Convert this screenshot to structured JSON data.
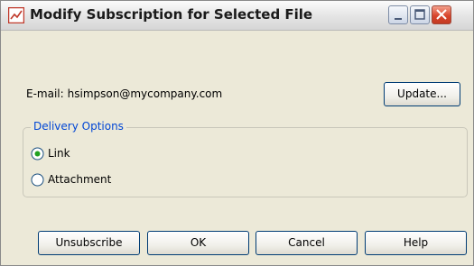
{
  "window": {
    "title": "Modify Subscription for Selected File",
    "icon": "chart-icon"
  },
  "email": {
    "label": "E-mail:",
    "value": "hsimpson@mycompany.com",
    "update_label": "Update..."
  },
  "delivery": {
    "legend": "Delivery Options",
    "options": [
      {
        "label": "Link",
        "selected": true
      },
      {
        "label": "Attachment",
        "selected": false
      }
    ]
  },
  "buttons": {
    "unsubscribe": "Unsubscribe",
    "ok": "OK",
    "cancel": "Cancel",
    "help": "Help"
  },
  "colors": {
    "legend": "#0046d5",
    "close_button": "#d8452c"
  }
}
